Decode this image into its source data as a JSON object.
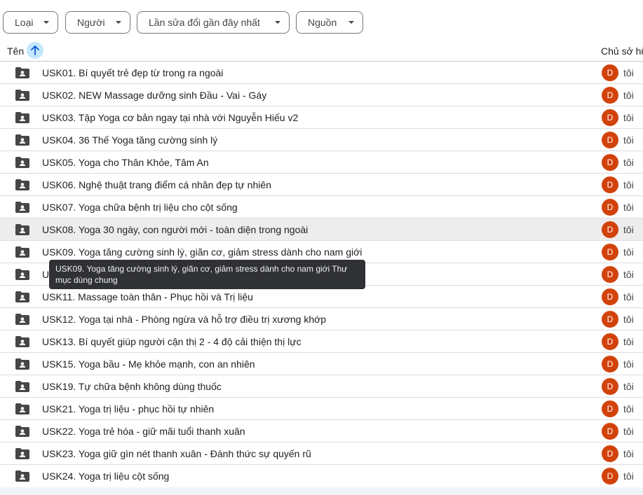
{
  "filters": [
    {
      "label": "Loại"
    },
    {
      "label": "Người"
    },
    {
      "label": "Lần sửa đổi gần đây nhất"
    },
    {
      "label": "Nguồn"
    }
  ],
  "header": {
    "name_label": "Tên",
    "owner_label": "Chủ sở hữu"
  },
  "rows": [
    {
      "name": "USK01. Bí quyết trẻ đẹp từ trong ra ngoài",
      "avatar": "D",
      "owner": "tôi"
    },
    {
      "name": "USK02. NEW Massage dưỡng sinh Đầu - Vai - Gáy",
      "avatar": "D",
      "owner": "tôi"
    },
    {
      "name": "USK03. Tập Yoga cơ bản ngay tại nhà với Nguyễn Hiếu v2",
      "avatar": "D",
      "owner": "tôi"
    },
    {
      "name": "USK04. 36 Thế Yoga tăng cường sinh lý",
      "avatar": "D",
      "owner": "tôi"
    },
    {
      "name": "USK05. Yoga cho Thân Khỏe, Tâm An",
      "avatar": "D",
      "owner": "tôi"
    },
    {
      "name": "USK06. Nghệ thuật trang điểm cá nhân đẹp tự nhiên",
      "avatar": "D",
      "owner": "tôi"
    },
    {
      "name": "USK07. Yoga chữa bệnh trị liệu cho cột sống",
      "avatar": "D",
      "owner": "tôi"
    },
    {
      "name": "USK08. Yoga 30 ngày, con người mới - toàn diện trong ngoài",
      "avatar": "D",
      "owner": "tôi"
    },
    {
      "name": "USK09. Yoga tăng cường sinh lý, giãn cơ, giảm stress dành cho nam giới",
      "avatar": "D",
      "owner": "tôi"
    },
    {
      "name": "U",
      "avatar": "D",
      "owner": "tôi"
    },
    {
      "name": "USK11. Massage toàn thân - Phục hồi và Trị liệu",
      "avatar": "D",
      "owner": "tôi"
    },
    {
      "name": "USK12. Yoga tại nhà - Phòng ngừa và hỗ trợ điều trị xương khớp",
      "avatar": "D",
      "owner": "tôi"
    },
    {
      "name": "USK13. Bí quyết giúp người cận thị 2 - 4 độ cải thiện thị lực",
      "avatar": "D",
      "owner": "tôi"
    },
    {
      "name": "USK15. Yoga bầu - Mẹ khỏe mạnh, con an nhiên",
      "avatar": "D",
      "owner": "tôi"
    },
    {
      "name": "USK19. Tự chữa bệnh không dùng thuốc",
      "avatar": "D",
      "owner": "tôi"
    },
    {
      "name": "USK21. Yoga trị liệu - phục hồi tự nhiên",
      "avatar": "D",
      "owner": "tôi"
    },
    {
      "name": "USK22. Yoga trẻ hóa - giữ mãi tuổi thanh xuân",
      "avatar": "D",
      "owner": "tôi"
    },
    {
      "name": "USK23. Yoga giữ gìn nét thanh xuân - Đánh thức sự quyến rũ",
      "avatar": "D",
      "owner": "tôi"
    },
    {
      "name": "USK24. Yoga trị liệu cột sống",
      "avatar": "D",
      "owner": "tôi"
    }
  ],
  "tooltip": {
    "text": "USK09. Yoga tăng cường sinh lý, giãn cơ, giảm stress dành cho nam giới Thư mục dùng chung"
  },
  "icons": {
    "sort": "arrow-up-icon",
    "row": "shared-folder-icon",
    "chip": "caret-down-icon"
  },
  "colors": {
    "avatar": "#d2420b",
    "sort_highlight": "#c2e7ff",
    "hover_row": "#ededed",
    "tooltip_bg": "#303134"
  }
}
